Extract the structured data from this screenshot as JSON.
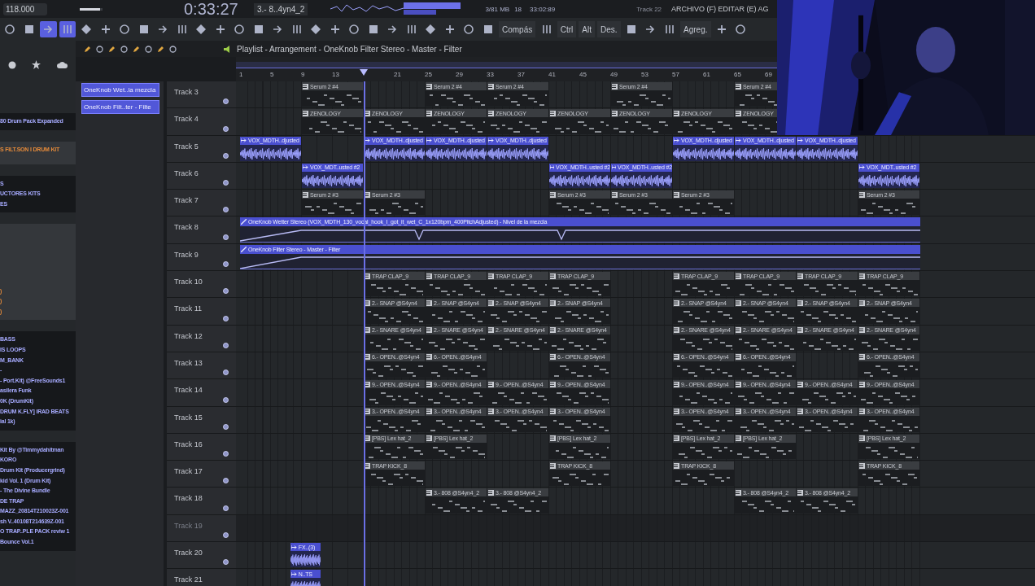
{
  "header": {
    "tempo": "118.000",
    "pitch": {
      "level": 0.9
    },
    "time": "0:33:27",
    "pattern": "3.- 8..4yn4_2",
    "memory": "3/81 MB",
    "voices": "18",
    "clock": "33:02:89",
    "hint": "Track 22",
    "menu": "ARCHIVO (F) EDITAR (E) AG"
  },
  "toolbar": [
    {
      "kind": "icon",
      "selected": false
    },
    {
      "kind": "icon",
      "selected": false
    },
    {
      "kind": "icon",
      "selected": true
    },
    {
      "kind": "icon",
      "selected": true
    },
    {
      "kind": "icon",
      "selected": false
    },
    {
      "kind": "icon",
      "selected": false
    },
    {
      "kind": "icon",
      "selected": false
    },
    {
      "kind": "icon",
      "selected": false
    },
    {
      "kind": "icon",
      "selected": false
    },
    {
      "kind": "icon",
      "selected": false
    },
    {
      "kind": "icon",
      "selected": false
    },
    {
      "kind": "icon",
      "selected": false
    },
    {
      "kind": "icon",
      "selected": false
    },
    {
      "kind": "icon",
      "selected": false
    },
    {
      "kind": "icon",
      "selected": false
    },
    {
      "kind": "icon",
      "selected": false
    },
    {
      "kind": "icon",
      "selected": false
    },
    {
      "kind": "icon",
      "selected": false
    },
    {
      "kind": "icon",
      "selected": false
    },
    {
      "kind": "icon",
      "selected": false
    },
    {
      "kind": "icon",
      "selected": false
    },
    {
      "kind": "icon",
      "selected": false
    },
    {
      "kind": "icon",
      "selected": false
    },
    {
      "kind": "icon",
      "selected": false
    },
    {
      "kind": "icon",
      "selected": false
    },
    {
      "kind": "icon",
      "selected": false
    },
    {
      "kind": "text",
      "label": "Compás",
      "selected": false
    },
    {
      "kind": "icon",
      "selected": false
    },
    {
      "kind": "text",
      "label": "Ctrl",
      "selected": false
    },
    {
      "kind": "text",
      "label": "Alt",
      "selected": false
    },
    {
      "kind": "text",
      "label": "Des.",
      "selected": false
    },
    {
      "kind": "icon",
      "selected": false
    },
    {
      "kind": "icon",
      "selected": false
    },
    {
      "kind": "icon",
      "selected": false
    },
    {
      "kind": "text",
      "label": "Agreg.",
      "selected": false
    },
    {
      "kind": "icon",
      "selected": false
    },
    {
      "kind": "icon",
      "selected": false
    }
  ],
  "playlist": {
    "title": "Playlist - Arrangement - OneKnob Filter Stereo - Master - Filter",
    "playhead": {
      "level": 0.1818
    }
  },
  "ruler": [
    "1",
    "5",
    "9",
    "13",
    "21",
    "25",
    "29",
    "33",
    "37",
    "41",
    "45",
    "49",
    "53",
    "57",
    "61",
    "65",
    "69"
  ],
  "browser": [
    {
      "kind": "dark",
      "items": [
        "80 Drum Pack Expanded"
      ]
    },
    {
      "kind": "grey",
      "items": [
        "S FILT.SON I DRUM KIT"
      ]
    },
    {
      "kind": "dark",
      "items": [
        "S",
        "UCTORES KITS",
        "ES"
      ]
    },
    {
      "kind": "grey",
      "items": [
        ")",
        ")",
        ")"
      ]
    },
    {
      "kind": "dark",
      "items": [
        "BASS",
        "IS LOOPS",
        "M_BANK",
        "-",
        "- Port.Kit) @FreeSounds1",
        "asilera Funk",
        "0K (DrumKit)",
        "DRUM K.FLY] IRAD BEATS",
        "ial 1k)"
      ]
    },
    {
      "kind": "dark",
      "items": [
        "Kit By @Timmydahitman",
        "KORO",
        "Drum Kit (Producergrind)",
        "kid Vol. 1 (Drum Kit)",
        "- The Divine Bundle",
        "DE TRAP",
        "MAZZ_20814T210023Z-001",
        "sh V..40108T214639Z-001",
        "O TRAP..PLE PACK reviw 1",
        "Bounce Vol.1"
      ]
    }
  ],
  "picker": [
    "OneKnob Wet..la mezcla",
    "OneKnob Filt..ter - Filte"
  ],
  "tracks": [
    {
      "name": "Track 3",
      "enabled": true,
      "slots": [
        {
          "kind": "empty"
        },
        {
          "kind": "pattern",
          "label": "Serum 2 #4"
        },
        {
          "kind": "empty"
        },
        {
          "kind": "pattern",
          "label": "Serum 2 #4"
        },
        {
          "kind": "pattern",
          "label": "Serum 2 #4"
        },
        {
          "kind": "empty"
        },
        {
          "kind": "pattern",
          "label": "Serum 2 #4"
        },
        {
          "kind": "empty"
        },
        {
          "kind": "pattern",
          "label": "Serum 2 #4"
        }
      ]
    },
    {
      "name": "Track 4",
      "enabled": true,
      "slots": [
        {
          "kind": "empty"
        },
        {
          "kind": "pattern",
          "label": "ZENOLOGY"
        },
        {
          "kind": "pattern",
          "label": "ZENOLOGY"
        },
        {
          "kind": "pattern",
          "label": "ZENOLOGY"
        },
        {
          "kind": "pattern",
          "label": "ZENOLOGY"
        },
        {
          "kind": "pattern",
          "label": "ZENOLOGY"
        },
        {
          "kind": "pattern",
          "label": "ZENOLOGY"
        },
        {
          "kind": "pattern",
          "label": "ZENOLOGY"
        },
        {
          "kind": "pattern",
          "label": "ZENOLOGY"
        }
      ]
    },
    {
      "name": "Track 5",
      "enabled": true,
      "slots": [
        {
          "kind": "audio",
          "label": "VOX_MDTH..djusted"
        },
        {
          "kind": "empty"
        },
        {
          "kind": "audio",
          "label": "VOX_MDTH..djusted"
        },
        {
          "kind": "audio",
          "label": "VOX_MDTH..djusted"
        },
        {
          "kind": "audio",
          "label": "VOX_MDTH..djusted"
        },
        {
          "kind": "empty"
        },
        {
          "kind": "empty"
        },
        {
          "kind": "audio",
          "label": "VOX_MDTH..djusted"
        },
        {
          "kind": "audio",
          "label": "VOX_MDTH..djusted"
        },
        {
          "kind": "audio",
          "label": "VOX_MDTH..djusted"
        }
      ]
    },
    {
      "name": "Track 6",
      "enabled": true,
      "slots": [
        {
          "kind": "empty"
        },
        {
          "kind": "audio",
          "label": "VOX_MDT..usted #2"
        },
        {
          "kind": "empty"
        },
        {
          "kind": "empty"
        },
        {
          "kind": "empty"
        },
        {
          "kind": "audio",
          "label": "VOX_MDTH..usted #2"
        },
        {
          "kind": "audio",
          "label": "VOX_MDTH..usted #2"
        },
        {
          "kind": "empty"
        },
        {
          "kind": "empty"
        },
        {
          "kind": "empty"
        },
        {
          "kind": "audio",
          "label": "VOX_MDT..usted #2"
        }
      ]
    },
    {
      "name": "Track 7",
      "enabled": true,
      "slots": [
        {
          "kind": "empty"
        },
        {
          "kind": "pattern",
          "label": "Serum 2 #3"
        },
        {
          "kind": "pattern",
          "label": "Serum 2 #3"
        },
        {
          "kind": "empty"
        },
        {
          "kind": "empty"
        },
        {
          "kind": "pattern",
          "label": "Serum 2 #3"
        },
        {
          "kind": "pattern",
          "label": "Serum 2 #3"
        },
        {
          "kind": "pattern",
          "label": "Serum 2 #3"
        },
        {
          "kind": "empty"
        },
        {
          "kind": "empty"
        },
        {
          "kind": "pattern",
          "label": "Serum 2 #3"
        }
      ]
    },
    {
      "name": "Track 8",
      "enabled": true,
      "slots": [
        {
          "kind": "automation",
          "label": "OneKnob Wetter Stereo (VOX_MDTH_130_vocal_hook_I_got_it_wet_C_1x120bpm_400PitchAdjusted) - Nivel de la mezcla"
        }
      ]
    },
    {
      "name": "Track 9",
      "enabled": true,
      "slots": [
        {
          "kind": "automation",
          "label": "OneKnob Filter Stereo - Master - Filter"
        }
      ]
    },
    {
      "name": "Track 10",
      "enabled": true,
      "slots": [
        {
          "kind": "empty"
        },
        {
          "kind": "empty"
        },
        {
          "kind": "pattern",
          "label": "TRAP CLAP_9"
        },
        {
          "kind": "pattern",
          "label": "TRAP CLAP_9"
        },
        {
          "kind": "pattern",
          "label": "TRAP CLAP_9"
        },
        {
          "kind": "pattern",
          "label": "TRAP CLAP_9"
        },
        {
          "kind": "empty"
        },
        {
          "kind": "pattern",
          "label": "TRAP CLAP_9"
        },
        {
          "kind": "pattern",
          "label": "TRAP CLAP_9"
        },
        {
          "kind": "pattern",
          "label": "TRAP CLAP_9"
        },
        {
          "kind": "pattern",
          "label": "TRAP CLAP_9"
        }
      ]
    },
    {
      "name": "Track 11",
      "enabled": true,
      "slots": [
        {
          "kind": "empty"
        },
        {
          "kind": "empty"
        },
        {
          "kind": "pattern",
          "label": "2.- SNAP @S4yn4"
        },
        {
          "kind": "pattern",
          "label": "2.- SNAP @S4yn4"
        },
        {
          "kind": "pattern",
          "label": "2.- SNAP @S4yn4"
        },
        {
          "kind": "pattern",
          "label": "2.- SNAP @S4yn4"
        },
        {
          "kind": "empty"
        },
        {
          "kind": "pattern",
          "label": "2.- SNAP @S4yn4"
        },
        {
          "kind": "pattern",
          "label": "2.- SNAP @S4yn4"
        },
        {
          "kind": "pattern",
          "label": "2.- SNAP @S4yn4"
        },
        {
          "kind": "pattern",
          "label": "2.- SNAP @S4yn4"
        }
      ]
    },
    {
      "name": "Track 12",
      "enabled": true,
      "slots": [
        {
          "kind": "empty"
        },
        {
          "kind": "empty"
        },
        {
          "kind": "pattern",
          "label": "2.- SNARE @S4yn4"
        },
        {
          "kind": "pattern",
          "label": "2.- SNARE @S4yn4"
        },
        {
          "kind": "pattern",
          "label": "2.- SNARE @S4yn4"
        },
        {
          "kind": "pattern",
          "label": "2.- SNARE @S4yn4"
        },
        {
          "kind": "empty"
        },
        {
          "kind": "pattern",
          "label": "2.- SNARE @S4yn4"
        },
        {
          "kind": "pattern",
          "label": "2.- SNARE @S4yn4"
        },
        {
          "kind": "pattern",
          "label": "2.- SNARE @S4yn4"
        },
        {
          "kind": "pattern",
          "label": "2.- SNARE @S4yn4"
        }
      ]
    },
    {
      "name": "Track 13",
      "enabled": true,
      "slots": [
        {
          "kind": "empty"
        },
        {
          "kind": "empty"
        },
        {
          "kind": "pattern",
          "label": "6.- OPEN..@S4yn4"
        },
        {
          "kind": "pattern",
          "label": "6.- OPEN..@S4yn4"
        },
        {
          "kind": "empty"
        },
        {
          "kind": "pattern",
          "label": "6.- OPEN..@S4yn4"
        },
        {
          "kind": "empty"
        },
        {
          "kind": "pattern",
          "label": "6.- OPEN..@S4yn4"
        },
        {
          "kind": "pattern",
          "label": "6.- OPEN..@S4yn4"
        },
        {
          "kind": "empty"
        },
        {
          "kind": "pattern",
          "label": "6.- OPEN..@S4yn4"
        }
      ]
    },
    {
      "name": "Track 14",
      "enabled": true,
      "slots": [
        {
          "kind": "empty"
        },
        {
          "kind": "empty"
        },
        {
          "kind": "pattern",
          "label": "9.- OPEN..@S4yn4"
        },
        {
          "kind": "pattern",
          "label": "9.- OPEN..@S4yn4"
        },
        {
          "kind": "pattern",
          "label": "9.- OPEN..@S4yn4"
        },
        {
          "kind": "pattern",
          "label": "9.- OPEN..@S4yn4"
        },
        {
          "kind": "empty"
        },
        {
          "kind": "pattern",
          "label": "9.- OPEN..@S4yn4"
        },
        {
          "kind": "pattern",
          "label": "9.- OPEN..@S4yn4"
        },
        {
          "kind": "pattern",
          "label": "9.- OPEN..@S4yn4"
        },
        {
          "kind": "pattern",
          "label": "9.- OPEN..@S4yn4"
        }
      ]
    },
    {
      "name": "Track 15",
      "enabled": true,
      "slots": [
        {
          "kind": "empty"
        },
        {
          "kind": "empty"
        },
        {
          "kind": "pattern",
          "label": "3.- OPEN..@S4yn4"
        },
        {
          "kind": "pattern",
          "label": "3.- OPEN..@S4yn4"
        },
        {
          "kind": "pattern",
          "label": "3.- OPEN..@S4yn4"
        },
        {
          "kind": "pattern",
          "label": "3.- OPEN..@S4yn4"
        },
        {
          "kind": "empty"
        },
        {
          "kind": "pattern",
          "label": "3.- OPEN..@S4yn4"
        },
        {
          "kind": "pattern",
          "label": "3.- OPEN..@S4yn4"
        },
        {
          "kind": "pattern",
          "label": "3.- OPEN..@S4yn4"
        },
        {
          "kind": "pattern",
          "label": "3.- OPEN..@S4yn4"
        }
      ]
    },
    {
      "name": "Track 16",
      "enabled": true,
      "slots": [
        {
          "kind": "empty"
        },
        {
          "kind": "empty"
        },
        {
          "kind": "pattern",
          "label": "[PBS] Lex hat_2"
        },
        {
          "kind": "pattern",
          "label": "[PBS] Lex hat_2"
        },
        {
          "kind": "empty"
        },
        {
          "kind": "pattern",
          "label": "[PBS] Lex hat_2"
        },
        {
          "kind": "empty"
        },
        {
          "kind": "pattern",
          "label": "[PBS] Lex hat_2"
        },
        {
          "kind": "pattern",
          "label": "[PBS] Lex hat_2"
        },
        {
          "kind": "empty"
        },
        {
          "kind": "pattern",
          "label": "[PBS] Lex hat_2"
        }
      ]
    },
    {
      "name": "Track 17",
      "enabled": true,
      "slots": [
        {
          "kind": "empty"
        },
        {
          "kind": "empty"
        },
        {
          "kind": "pattern",
          "label": "TRAP KICK_8"
        },
        {
          "kind": "empty"
        },
        {
          "kind": "empty"
        },
        {
          "kind": "pattern",
          "label": "TRAP KICK_8"
        },
        {
          "kind": "empty"
        },
        {
          "kind": "pattern",
          "label": "TRAP KICK_8"
        },
        {
          "kind": "empty"
        },
        {
          "kind": "empty"
        },
        {
          "kind": "pattern",
          "label": "TRAP KICK_8"
        }
      ]
    },
    {
      "name": "Track 18",
      "enabled": true,
      "slots": [
        {
          "kind": "empty"
        },
        {
          "kind": "empty"
        },
        {
          "kind": "empty"
        },
        {
          "kind": "pattern",
          "label": "3.- 808 @S4yn4_2"
        },
        {
          "kind": "pattern",
          "label": "3.- 808 @S4yn4_2"
        },
        {
          "kind": "empty"
        },
        {
          "kind": "empty"
        },
        {
          "kind": "empty"
        },
        {
          "kind": "pattern",
          "label": "3.- 808 @S4yn4_2"
        },
        {
          "kind": "pattern",
          "label": "3.- 808 @S4yn4_2"
        }
      ]
    },
    {
      "name": "Track 19",
      "enabled": false
    },
    {
      "name": "Track 20",
      "enabled": true,
      "slots": [
        {
          "kind": "audio_short",
          "label": "FX..(3)"
        }
      ]
    },
    {
      "name": "Track 21",
      "enabled": true,
      "slots": [
        {
          "kind": "audio_short",
          "label": "N..TS"
        }
      ]
    }
  ]
}
